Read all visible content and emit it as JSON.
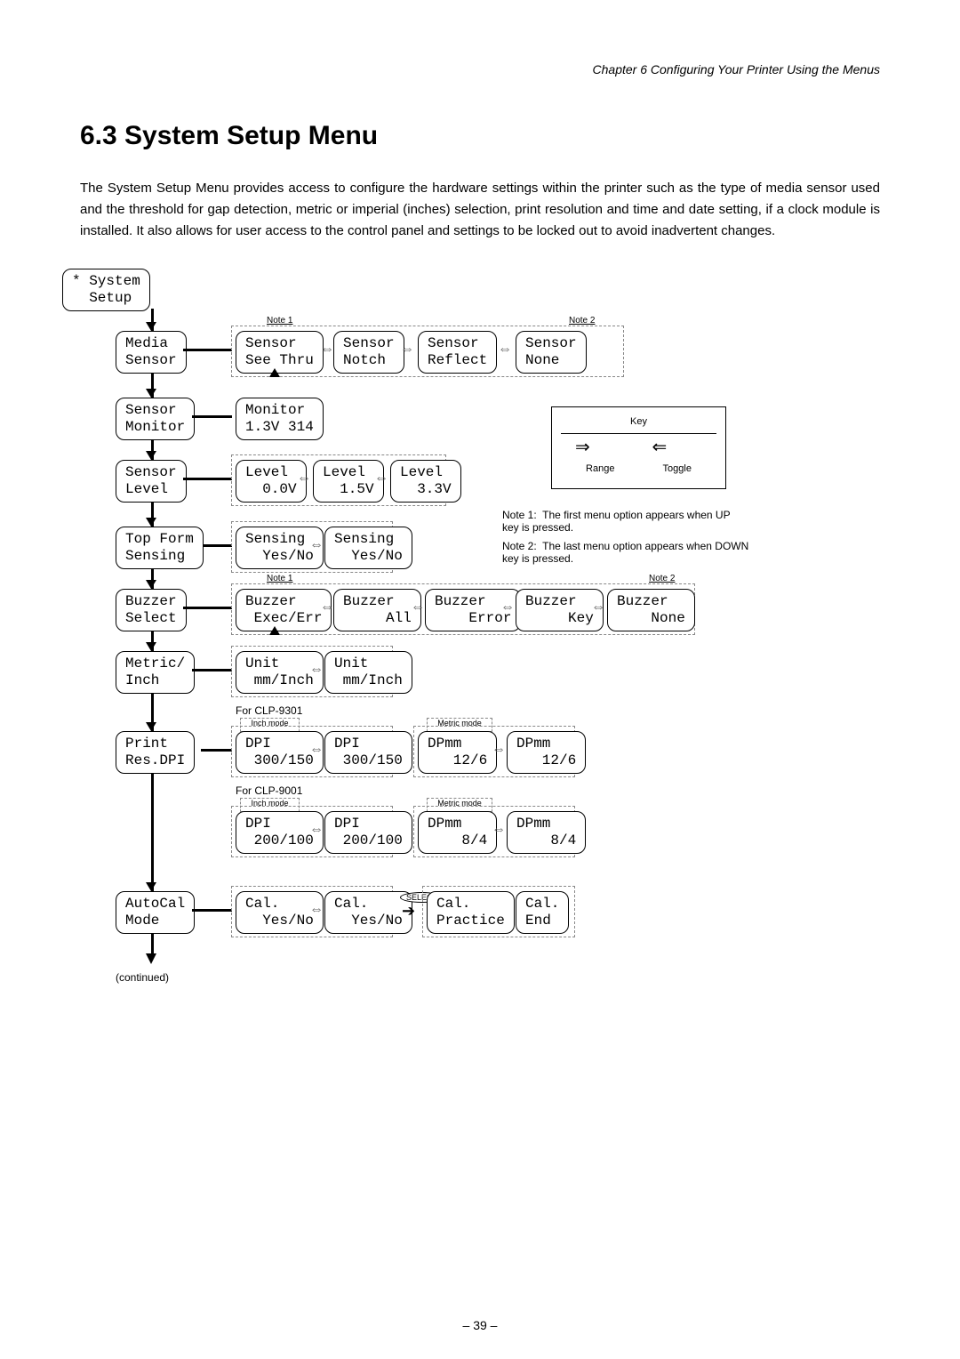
{
  "chapter_header": "Chapter 6   Configuring Your Printer Using the Menus",
  "section_title": "6.3   System Setup Menu",
  "body_text": "The System Setup Menu provides access to configure the hardware settings within the printer such as the type of media sensor used and the threshold for gap detection, metric or imperial (inches) selection, print resolution and time and date setting, if a clock module is installed. It also allows for user access to the control panel and settings to be locked out to avoid inadvertent changes.",
  "root_menu": "* System\n  Setup",
  "note1_label": "Note 1",
  "note2_label": "Note 2",
  "rows": {
    "media_sensor": {
      "main": "Media\nSensor",
      "opts": [
        "Sensor\nSee Thru",
        "Sensor\nNotch",
        "Sensor\nReflect",
        "Sensor\nNone"
      ]
    },
    "sensor_monitor": {
      "main": "Sensor\nMonitor",
      "opts": [
        "Monitor\n1.3V 314"
      ]
    },
    "sensor_level": {
      "main": "Sensor\nLevel",
      "opts": [
        "Level\n  0.0V",
        "Level\n  1.5V",
        "Level\n  3.3V"
      ]
    },
    "top_form": {
      "main": "Top Form\nSensing",
      "opts": [
        "Sensing\n  Yes/No",
        "Sensing\n  Yes/No"
      ]
    },
    "buzzer": {
      "main": "Buzzer\nSelect",
      "opts": [
        "Buzzer\n Exec/Err",
        "Buzzer\n     All",
        "Buzzer\n    Error",
        "Buzzer\n     Key",
        "Buzzer\n    None"
      ]
    },
    "metric_inch": {
      "main": "Metric/\nInch",
      "opts": [
        "Unit\n mm/Inch",
        "Unit\n mm/Inch"
      ]
    },
    "print_res": {
      "main": "Print\nRes.DPI",
      "clp9301_label": "For CLP-9301",
      "inch_mode_label": "Inch mode",
      "metric_mode_label": "Metric mode",
      "inch_opts_9301": [
        "DPI\n 300/150",
        "DPI\n 300/150"
      ],
      "metric_opts_9301": [
        "DPmm\n   12/6",
        "DPmm\n   12/6"
      ],
      "clp9001_label": "For CLP-9001",
      "inch_opts_9001": [
        "DPI\n 200/100",
        "DPI\n 200/100"
      ],
      "metric_opts_9001": [
        "DPmm\n    8/4",
        "DPmm\n    8/4"
      ]
    },
    "autocal": {
      "main": "AutoCal\nMode",
      "opts": [
        "Cal.\n  Yes/No",
        "Cal.\n  Yes/No"
      ],
      "select_label": "SELECT",
      "practice": [
        "Cal.\nPractice",
        "Cal.\nEnd"
      ]
    }
  },
  "key_legend": {
    "title": "Key",
    "range_label": "Range",
    "toggle_label": "Toggle"
  },
  "note1_text": "The first menu option appears when UP key is pressed.",
  "note1_prefix": "Note 1:",
  "note2_text": "The last menu option appears when DOWN key is pressed.",
  "note2_prefix": "Note 2:",
  "continued": "(continued)",
  "page_number": "– 39 –"
}
